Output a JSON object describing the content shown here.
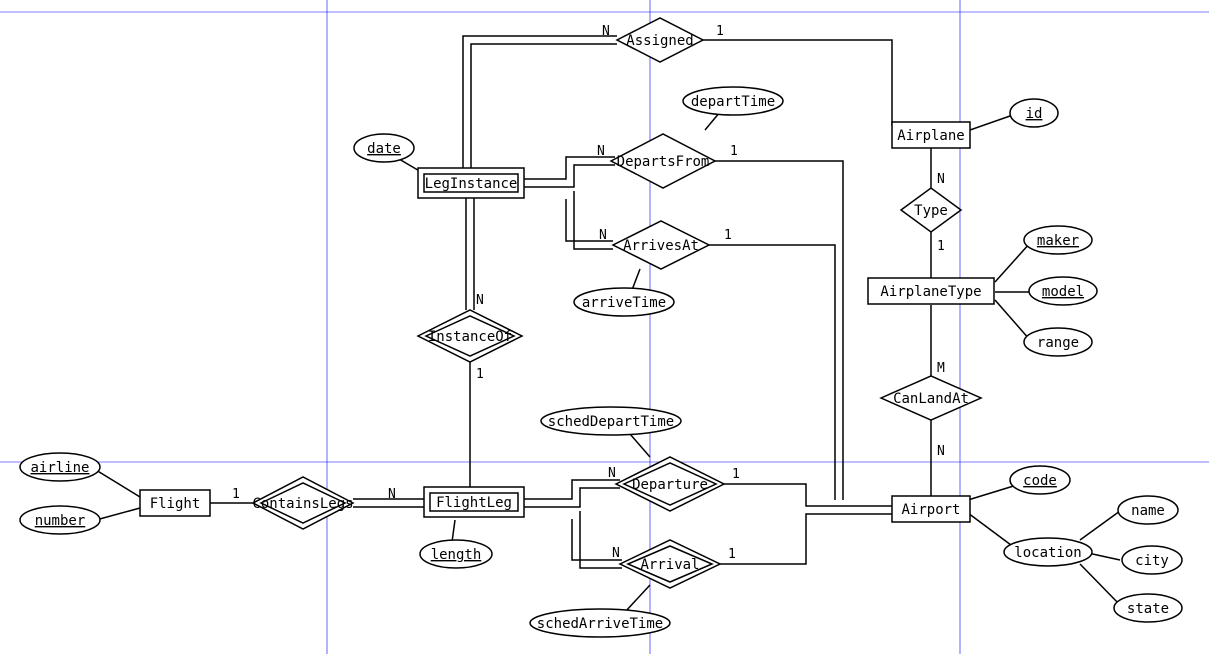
{
  "chart_data": {
    "type": "er-diagram",
    "entities": [
      {
        "id": "Flight",
        "label": "Flight",
        "weak": false,
        "attributes": [
          {
            "id": "airline",
            "label": "airline",
            "key": true
          },
          {
            "id": "number",
            "label": "number",
            "key": true
          }
        ]
      },
      {
        "id": "FlightLeg",
        "label": "FlightLeg",
        "weak": true,
        "attributes": [
          {
            "id": "length",
            "label": "length",
            "partial": true
          }
        ]
      },
      {
        "id": "LegInstance",
        "label": "LegInstance",
        "weak": true,
        "attributes": [
          {
            "id": "date",
            "label": "date",
            "partial": true
          }
        ]
      },
      {
        "id": "Airplane",
        "label": "Airplane",
        "weak": false,
        "attributes": [
          {
            "id": "id",
            "label": "id",
            "key": true
          }
        ]
      },
      {
        "id": "AirplaneType",
        "label": "AirplaneType",
        "weak": false,
        "attributes": [
          {
            "id": "maker",
            "label": "maker",
            "key": true
          },
          {
            "id": "model",
            "label": "model",
            "key": true
          },
          {
            "id": "range",
            "label": "range"
          }
        ]
      },
      {
        "id": "Airport",
        "label": "Airport",
        "weak": false,
        "attributes": [
          {
            "id": "code",
            "label": "code",
            "key": true
          },
          {
            "id": "location",
            "label": "location",
            "composite": [
              "name",
              "city",
              "state"
            ]
          }
        ]
      }
    ],
    "relationships": [
      {
        "id": "ContainsLegs",
        "label": "ContainsLegs",
        "identifying": true,
        "ends": [
          {
            "entity": "Flight",
            "card": "1"
          },
          {
            "entity": "FlightLeg",
            "card": "N"
          }
        ]
      },
      {
        "id": "InstanceOf",
        "label": "InstanceOf",
        "identifying": true,
        "ends": [
          {
            "entity": "FlightLeg",
            "card": "1"
          },
          {
            "entity": "LegInstance",
            "card": "N"
          }
        ]
      },
      {
        "id": "Departure",
        "label": "Departure",
        "identifying": true,
        "ends": [
          {
            "entity": "FlightLeg",
            "card": "N"
          },
          {
            "entity": "Airport",
            "card": "1"
          }
        ],
        "attributes": [
          {
            "id": "schedDepartTime",
            "label": "schedDepartTime"
          }
        ]
      },
      {
        "id": "Arrival",
        "label": "Arrival",
        "identifying": true,
        "ends": [
          {
            "entity": "FlightLeg",
            "card": "N"
          },
          {
            "entity": "Airport",
            "card": "1"
          }
        ],
        "attributes": [
          {
            "id": "schedArriveTime",
            "label": "schedArriveTime"
          }
        ]
      },
      {
        "id": "DepartsFrom",
        "label": "DepartsFrom",
        "identifying": false,
        "ends": [
          {
            "entity": "LegInstance",
            "card": "N"
          },
          {
            "entity": "Airport",
            "card": "1"
          }
        ],
        "attributes": [
          {
            "id": "departTime",
            "label": "departTime"
          }
        ]
      },
      {
        "id": "ArrivesAt",
        "label": "ArrivesAt",
        "identifying": false,
        "ends": [
          {
            "entity": "LegInstance",
            "card": "N"
          },
          {
            "entity": "Airport",
            "card": "1"
          }
        ],
        "attributes": [
          {
            "id": "arriveTime",
            "label": "arriveTime"
          }
        ]
      },
      {
        "id": "Assigned",
        "label": "Assigned",
        "identifying": false,
        "ends": [
          {
            "entity": "LegInstance",
            "card": "N"
          },
          {
            "entity": "Airplane",
            "card": "1"
          }
        ]
      },
      {
        "id": "Type",
        "label": "Type",
        "identifying": false,
        "ends": [
          {
            "entity": "Airplane",
            "card": "N"
          },
          {
            "entity": "AirplaneType",
            "card": "1"
          }
        ]
      },
      {
        "id": "CanLandAt",
        "label": "CanLandAt",
        "identifying": false,
        "ends": [
          {
            "entity": "AirplaneType",
            "card": "M"
          },
          {
            "entity": "Airport",
            "card": "N"
          }
        ]
      }
    ],
    "cardinality_labels": {
      "Assigned_left": "N",
      "Assigned_right": "1",
      "DepartsFrom_left": "N",
      "DepartsFrom_right": "1",
      "ArrivesAt_left": "N",
      "ArrivesAt_right": "1",
      "Type_top": "N",
      "Type_bottom": "1",
      "CanLandAt_top": "M",
      "CanLandAt_bottom": "N",
      "InstanceOf_top": "N",
      "InstanceOf_bottom": "1",
      "ContainsLegs_left": "1",
      "ContainsLegs_right": "N",
      "Departure_left": "N",
      "Departure_right": "1",
      "Arrival_left": "N",
      "Arrival_right": "1"
    }
  },
  "grid": {
    "color": "#0000ff"
  }
}
